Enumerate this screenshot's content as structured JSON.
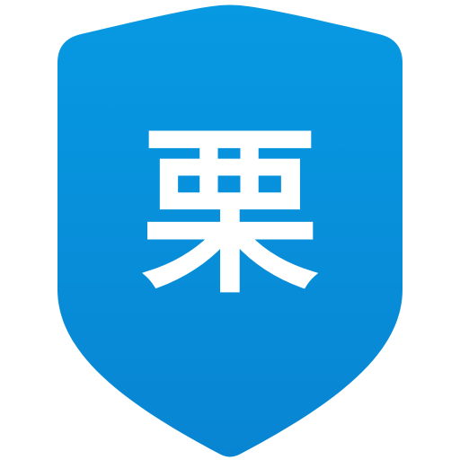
{
  "app_icon": {
    "character": "栗",
    "icon_name": "shield-icon",
    "colors": {
      "shield_top": "#0799E2",
      "shield_bottom": "#0885D2",
      "glyph": "#ffffff",
      "background": "#ffffff"
    }
  }
}
